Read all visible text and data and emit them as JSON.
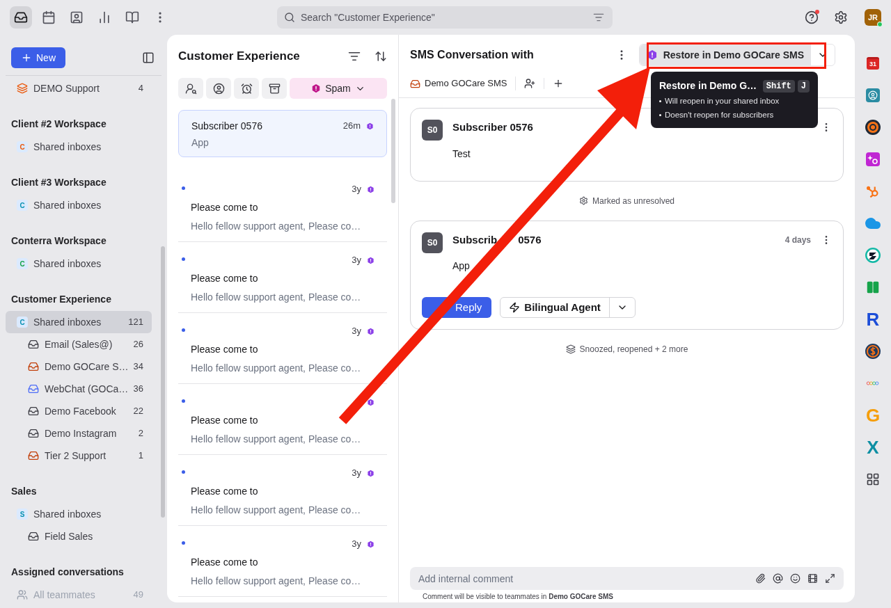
{
  "topbar": {
    "nav": [
      {
        "kind": "inbox",
        "selected": true
      },
      {
        "kind": "calendar",
        "selected": false
      },
      {
        "kind": "contacts",
        "selected": false
      },
      {
        "kind": "analytics",
        "selected": false
      },
      {
        "kind": "knowledge",
        "selected": false
      },
      {
        "kind": "more",
        "selected": false
      }
    ],
    "search": {
      "placeholder": "Search \"Customer Experience\""
    },
    "help_alert": true,
    "avatar": {
      "initials": "JR",
      "online": true
    }
  },
  "sidebar": {
    "new_button": "New",
    "sections": [
      {
        "items": [
          {
            "kind": "team",
            "label": "DEMO Support",
            "count": "4",
            "selected": false
          }
        ]
      },
      {
        "title": "Client #2 Workspace",
        "items": [
          {
            "kind": "workspace",
            "badge": "C",
            "color": "#ea580c",
            "label": "Shared inboxes",
            "selected": false
          }
        ]
      },
      {
        "title": "Client #3 Workspace",
        "items": [
          {
            "kind": "workspace",
            "badge": "C",
            "color": "#0891b2",
            "label": "Shared inboxes",
            "selected": false
          }
        ]
      },
      {
        "title": "Conterra Workspace",
        "items": [
          {
            "kind": "workspace",
            "badge": "C",
            "color": "#16a34a",
            "label": "Shared inboxes",
            "selected": false
          }
        ]
      },
      {
        "title": "Customer Experience",
        "items": [
          {
            "kind": "workspace",
            "badge": "C",
            "color": "#0891b2",
            "label": "Shared inboxes",
            "count": "121",
            "selected": true,
            "children": [
              {
                "kind": "inbox",
                "color": "#3f3f46",
                "label": "Email (Sales@)",
                "count": "26",
                "selected": false
              },
              {
                "kind": "inbox",
                "color": "#c2410c",
                "label": "Demo GOCare S…",
                "count": "34",
                "selected": false
              },
              {
                "kind": "inbox",
                "color": "#4f6ef7",
                "label": "WebChat (GOCa…",
                "count": "36",
                "selected": false
              },
              {
                "kind": "inbox",
                "color": "#3f3f46",
                "label": "Demo Facebook",
                "count": "22",
                "selected": false
              },
              {
                "kind": "inbox",
                "color": "#3f3f46",
                "label": "Demo Instagram",
                "count": "2",
                "selected": false
              },
              {
                "kind": "inbox",
                "color": "#c2410c",
                "label": "Tier 2 Support",
                "count": "1",
                "selected": false
              }
            ]
          }
        ]
      },
      {
        "title": "Sales",
        "items": [
          {
            "kind": "workspace",
            "badge": "S",
            "color": "#0891b2",
            "label": "Shared inboxes",
            "selected": false,
            "children": [
              {
                "kind": "inbox",
                "color": "#3f3f46",
                "label": "Field Sales",
                "selected": false
              }
            ]
          }
        ]
      },
      {
        "title": "Assigned conversations",
        "items": [
          {
            "kind": "teammates",
            "label": "All teammates",
            "count": "49",
            "selected": false
          }
        ]
      }
    ]
  },
  "list": {
    "title": "Customer Experience",
    "filters": [
      {
        "kind": "unassigned"
      },
      {
        "kind": "mine"
      },
      {
        "kind": "snoozed"
      },
      {
        "kind": "archived"
      }
    ],
    "status_menu": "Spam",
    "conversations": [
      {
        "sender": "Subscriber 0576",
        "time": "26m",
        "preview": "App",
        "selected": true,
        "unread": false
      },
      {
        "subject": "Please come to",
        "preview": "Hello fellow support agent, Please co…",
        "time": "3y",
        "selected": false,
        "unread": true
      },
      {
        "subject": "Please come to",
        "preview": "Hello fellow support agent, Please co…",
        "time": "3y",
        "selected": false,
        "unread": true
      },
      {
        "subject": "Please come to",
        "preview": "Hello fellow support agent, Please co…",
        "time": "3y",
        "selected": false,
        "unread": true
      },
      {
        "subject": "Please come to",
        "preview": "Hello fellow support agent, Please co…",
        "selected": false,
        "unread": true
      },
      {
        "subject": "Please come to",
        "preview": "Hello fellow support agent, Please co…",
        "time": "3y",
        "selected": false,
        "unread": true
      },
      {
        "subject": "Please come to",
        "preview": "Hello fellow support agent, Please co…",
        "time": "3y",
        "selected": false,
        "unread": true
      }
    ]
  },
  "conversation": {
    "title": "SMS Conversation with",
    "restore_button": "Restore in Demo GOCare SMS",
    "inbox": "Demo GOCare SMS",
    "tooltip": {
      "title": "Restore in Demo G…",
      "keys": [
        "Shift",
        "J"
      ],
      "bullets": [
        "Will reopen in your shared inbox",
        "Doesn't reopen for subscribers"
      ]
    },
    "timeline": [
      {
        "kind": "message",
        "initials": "S0",
        "author": "Subscriber 0576",
        "body": "Test"
      },
      {
        "kind": "status_event",
        "text": "Marked as unresolved"
      },
      {
        "kind": "message",
        "initials": "S0",
        "author": "Subscrib",
        "author_tail": "0576",
        "time": "4 days",
        "body": "App",
        "reply": "Reply",
        "macro": "Bilingual Agent"
      },
      {
        "kind": "activity_event",
        "text": "Snoozed, reopened + 2 more"
      }
    ],
    "composer": {
      "placeholder": "Add internal comment",
      "note": "Comment will be visible to teammates in **Demo GOCare SMS**"
    }
  },
  "rail": [
    {
      "kind": "calendar",
      "label": "31"
    },
    {
      "kind": "contacts"
    },
    {
      "kind": "ring"
    },
    {
      "kind": "sparkle"
    },
    {
      "kind": "hub"
    },
    {
      "kind": "cloud"
    },
    {
      "kind": "badge"
    },
    {
      "kind": "book"
    },
    {
      "kind": "letter",
      "label": "R",
      "color": "#1d4ed8"
    },
    {
      "kind": "coin"
    },
    {
      "kind": "rings"
    },
    {
      "kind": "letter",
      "label": "G",
      "color": "#f59e0b"
    },
    {
      "kind": "letter",
      "label": "X",
      "color": "#0e8fa3"
    },
    {
      "kind": "grid"
    }
  ],
  "annotations": {
    "frame": true,
    "arrow": true
  }
}
